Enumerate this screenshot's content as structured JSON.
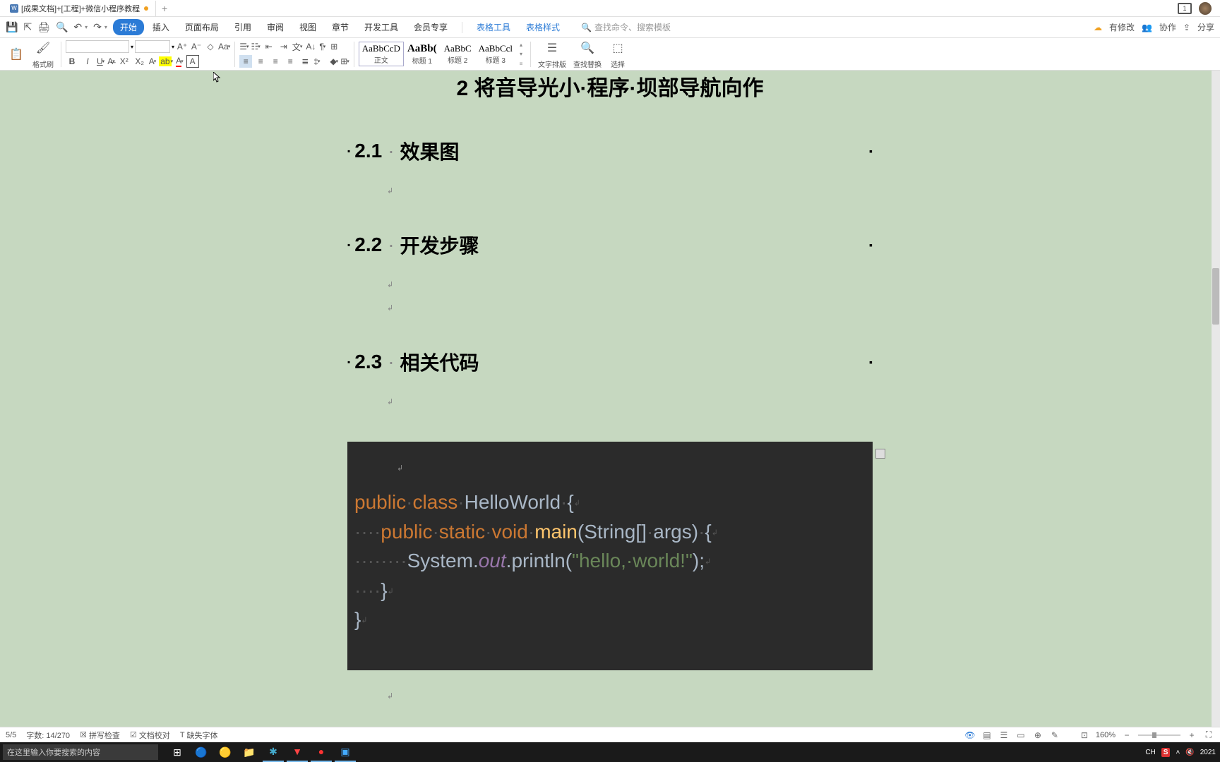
{
  "title_tab": "[成果文档]+[工程]+微信小程序教程",
  "menubar": [
    "开始",
    "插入",
    "页面布局",
    "引用",
    "审阅",
    "视图",
    "章节",
    "开发工具",
    "会员专享"
  ],
  "tool_tabs": [
    "表格工具",
    "表格样式"
  ],
  "search_placeholder": "查找命令、搜索模板",
  "right_status": {
    "pending": "有修改",
    "collab": "协作",
    "share": "分享"
  },
  "toolbar": {
    "paste": "粘贴",
    "format": "格式刷",
    "styles": [
      {
        "preview": "AaBbCcD",
        "label": "正文"
      },
      {
        "preview": "AaBb(",
        "label": "标题 1"
      },
      {
        "preview": "AaBbC",
        "label": "标题 2"
      },
      {
        "preview": "AaBbCcl",
        "label": "标题 3"
      }
    ],
    "text_layout": "文字排版",
    "find_replace": "查找替换",
    "select": "选择"
  },
  "document": {
    "title_partial": "2  将音导光小·程序·坝部导航向作",
    "h21_num": "2.1",
    "h21_txt": "效果图",
    "h22_num": "2.2",
    "h22_txt": "开发步骤",
    "h23_num": "2.3",
    "h23_txt": "相关代码",
    "code": {
      "l1": {
        "kw1": "public",
        "sp1": "·",
        "kw2": "class",
        "sp2": "·",
        "name": "HelloWorld",
        "sp3": "·",
        "brace": "{"
      },
      "l2": {
        "ind": "····",
        "kw1": "public",
        "sp1": "·",
        "kw2": "static",
        "sp2": "·",
        "kw3": "void",
        "sp3": "·",
        "meth": "main",
        "p1": "(",
        "t1": "String",
        "br": "[]",
        "sp4": "·",
        "arg": "args",
        "p2": ")",
        "sp5": "·",
        "brace": "{"
      },
      "l3": {
        "ind": "········",
        "cls": "System",
        "dot1": ".",
        "field": "out",
        "dot2": ".",
        "meth": "println",
        "p1": "(",
        "str": "\"hello,·world!\"",
        "p2": ")",
        "semi": ";"
      },
      "l4": {
        "ind": "····",
        "brace": "}"
      },
      "l5": {
        "brace": "}"
      }
    }
  },
  "status": {
    "page": "5/5",
    "words": "字数: 14/270",
    "spell": "拼写检查",
    "proof": "文档校对",
    "font_missing": "缺失字体",
    "zoom": "160%"
  },
  "taskbar": {
    "search": "在这里输入你要搜索的内容",
    "ime": "CH",
    "time_label": "2021"
  }
}
